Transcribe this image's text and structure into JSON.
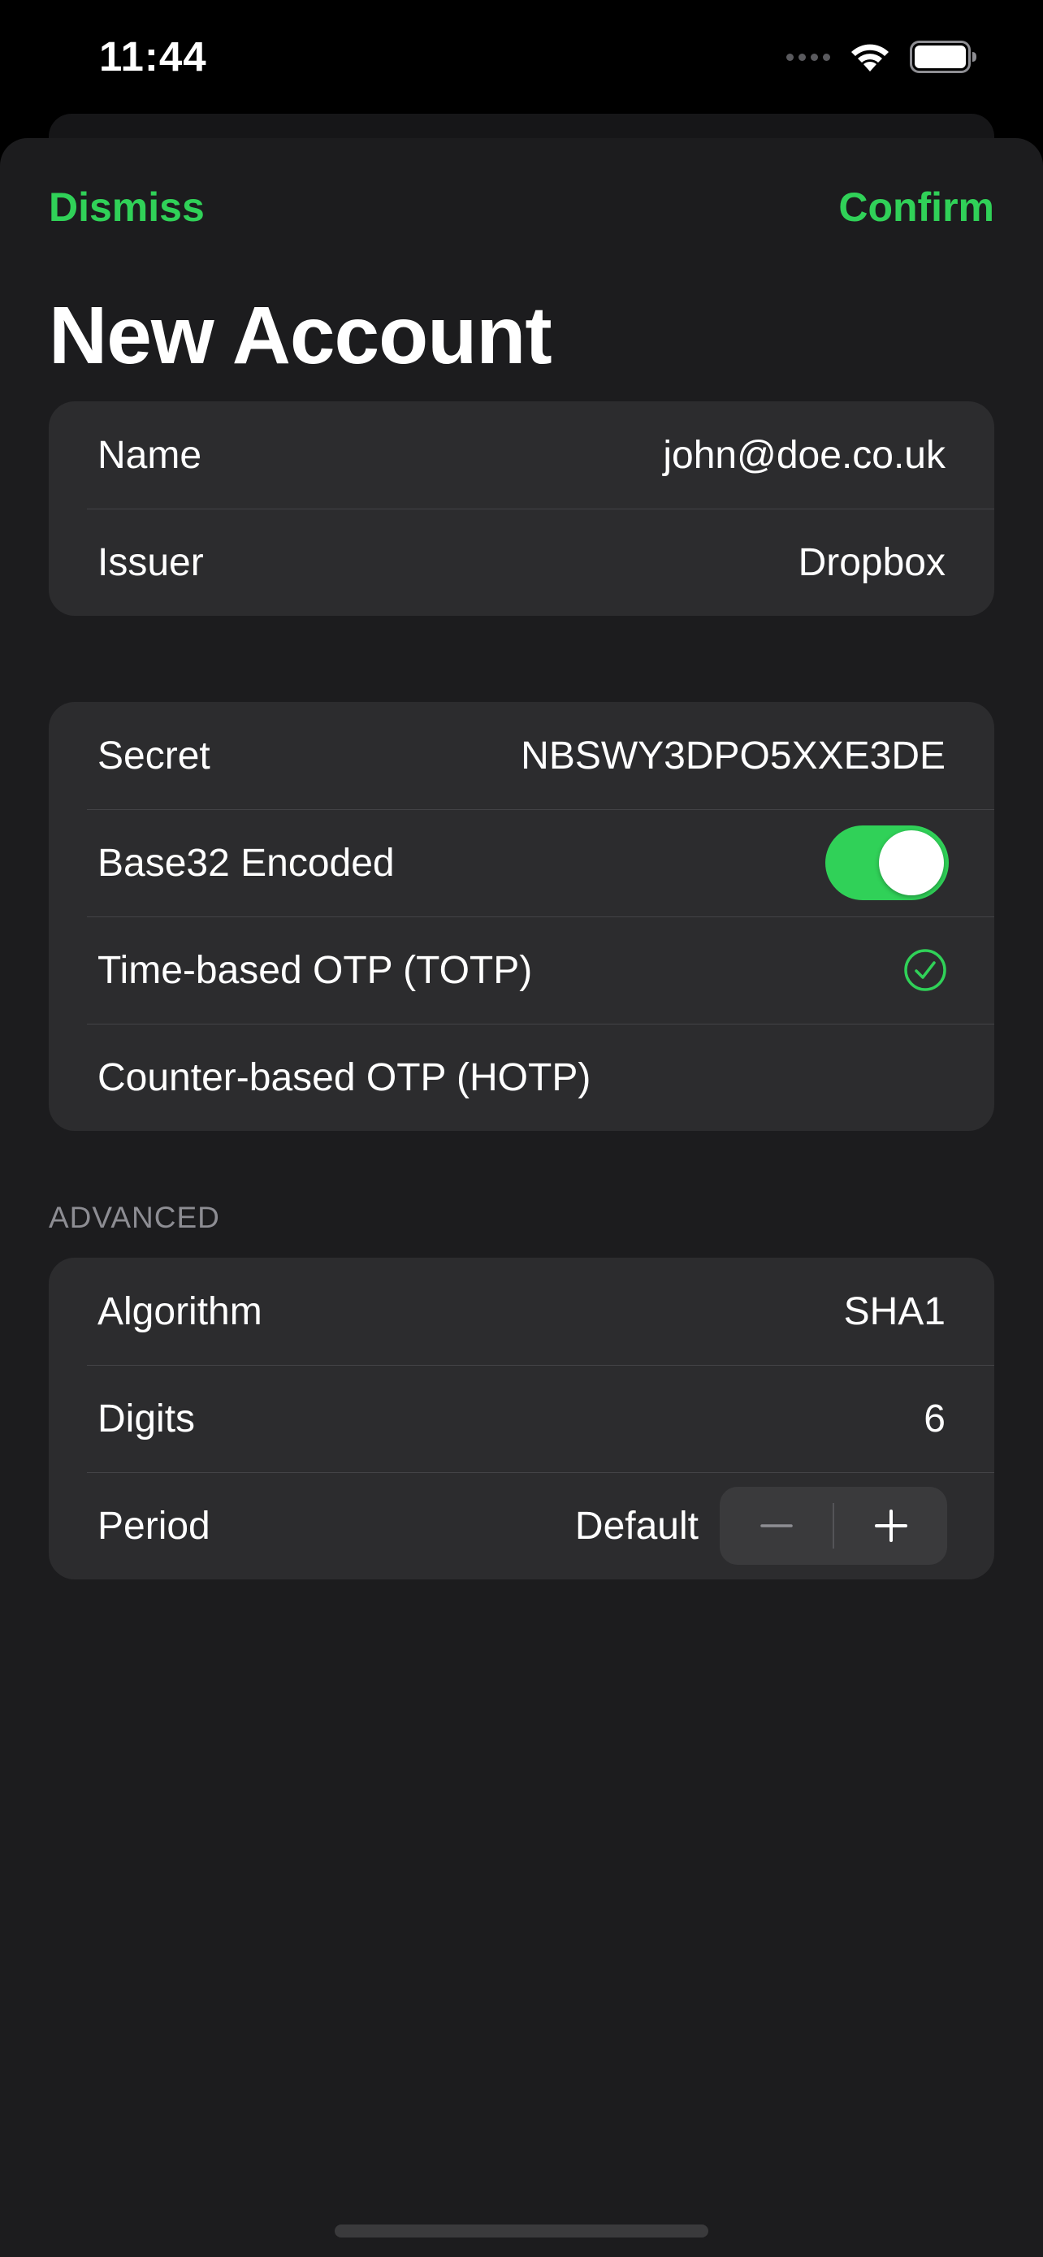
{
  "status_bar": {
    "time": "11:44"
  },
  "nav": {
    "dismiss_label": "Dismiss",
    "confirm_label": "Confirm",
    "accent_color": "#30d158"
  },
  "title": "New Account",
  "account_group": {
    "name_label": "Name",
    "name_value": "john@doe.co.uk",
    "issuer_label": "Issuer",
    "issuer_value": "Dropbox"
  },
  "secret_group": {
    "secret_label": "Secret",
    "secret_value": "NBSWY3DPO5XXE3DE",
    "base32_label": "Base32 Encoded",
    "base32_enabled": true,
    "totp_label": "Time-based OTP (TOTP)",
    "totp_selected": true,
    "hotp_label": "Counter-based OTP (HOTP)",
    "hotp_selected": false
  },
  "advanced": {
    "header": "ADVANCED",
    "algorithm_label": "Algorithm",
    "algorithm_value": "SHA1",
    "digits_label": "Digits",
    "digits_value": "6",
    "period_label": "Period",
    "period_value": "Default"
  },
  "icons": {
    "wifi": "wifi-icon",
    "battery": "battery-icon",
    "check": "checkmark-circle-icon",
    "minus": "minus-icon",
    "plus": "plus-icon"
  }
}
